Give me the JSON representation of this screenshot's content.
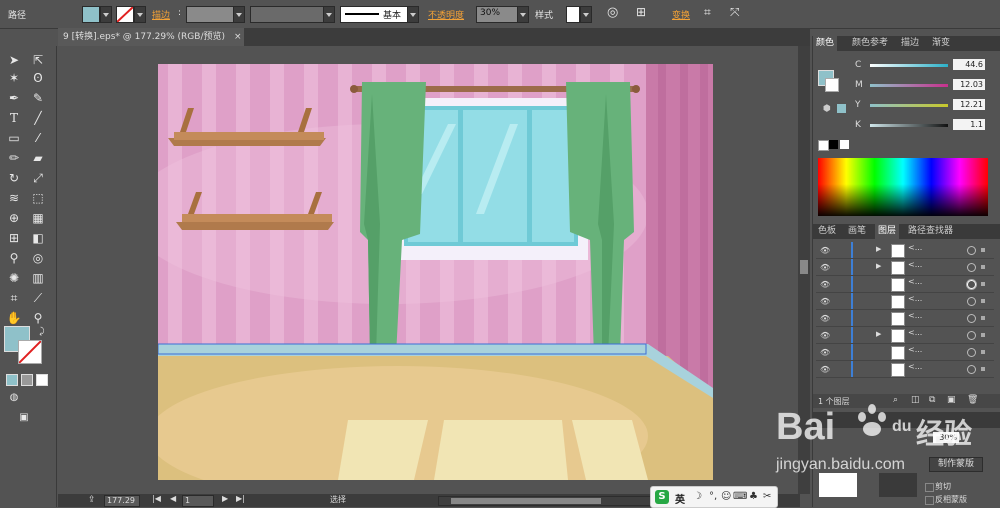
{
  "control_bar": {
    "path_label": "路径",
    "stroke_label": "描边",
    "stroke_style": "基本",
    "opacity_label": "不透明度",
    "opacity_value": "30%",
    "style_label": "样式",
    "transform_label": "变换"
  },
  "document_tab": {
    "title": "9 [转换].eps* @ 177.29% (RGB/预览)",
    "close_glyph": "×"
  },
  "color_panel": {
    "tabs": [
      "颜色",
      "颜色参考",
      "描边",
      "渐变"
    ],
    "channels": [
      {
        "label": "C",
        "value": "44.6",
        "color": "#2bb0c8"
      },
      {
        "label": "M",
        "value": "12.03",
        "color": "#c8308d"
      },
      {
        "label": "Y",
        "value": "12.21",
        "color": "#c8c82a"
      },
      {
        "label": "K",
        "value": "1.1",
        "color": "#888888"
      }
    ],
    "fill_color": "#8fc1c9"
  },
  "layers_panel": {
    "tabs": [
      "色板",
      "画笔",
      "图层",
      "路径查找器"
    ],
    "rows": [
      {
        "name": "<...",
        "arrow": "▶"
      },
      {
        "name": "<...",
        "arrow": "▶"
      },
      {
        "name": "<...",
        "arrow": ""
      },
      {
        "name": "<...",
        "arrow": ""
      },
      {
        "name": "<...",
        "arrow": ""
      },
      {
        "name": "<...",
        "arrow": "▶"
      },
      {
        "name": "<...",
        "arrow": ""
      },
      {
        "name": "<...",
        "arrow": ""
      }
    ],
    "layer_count": "1 个图层"
  },
  "transparency_panel": {
    "opacity_value": "30%",
    "make_mask_label": "制作蒙版",
    "clip_label": "剪切",
    "invert_label": "反相蒙版"
  },
  "status_bar": {
    "zoom": "177.29",
    "page": "1",
    "tool_name": "选择"
  },
  "ime_bar": {
    "label": "英",
    "logo": "S"
  },
  "watermark": {
    "brand": "Bai",
    "brand_cn": "经验",
    "brand_end": "du",
    "url": "jingyan.baidu.com"
  },
  "colors": {
    "ui_bg": "#535353",
    "accent": "#f4a236",
    "layer_bar": "#3d7fd6",
    "wall": "#dfa0c8",
    "curtain": "#67b27a",
    "floor": "#e7c98f",
    "window_glass": "#93dde6"
  }
}
